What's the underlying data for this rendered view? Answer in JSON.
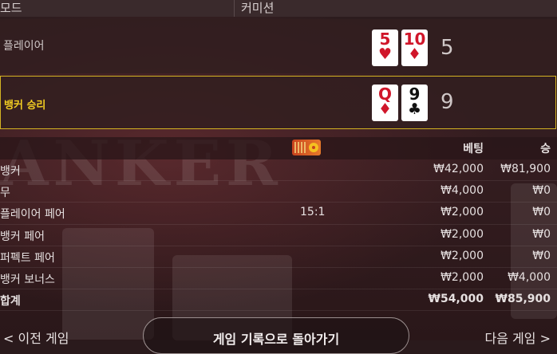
{
  "header": {
    "mode_label": "모드",
    "commission_label": "커미션"
  },
  "player": {
    "label": "플레이어",
    "cards": [
      {
        "rank": "5",
        "suit": "♥",
        "color": "red"
      },
      {
        "rank": "10",
        "suit": "♦",
        "color": "red"
      }
    ],
    "score": "5"
  },
  "banker": {
    "label": "뱅커 승리",
    "cards": [
      {
        "rank": "Q",
        "suit": "♦",
        "color": "red"
      },
      {
        "rank": "9",
        "suit": "♣",
        "color": "black"
      }
    ],
    "score": "9"
  },
  "background_text": "ANKER",
  "table": {
    "headers": {
      "bet": "베팅",
      "win": "승"
    },
    "rows": [
      {
        "name": "뱅커",
        "payout": "",
        "bet": "₩42,000",
        "win": "₩81,900"
      },
      {
        "name": "무",
        "payout": "",
        "bet": "₩4,000",
        "win": "₩0"
      },
      {
        "name": "플레이어 페어",
        "payout": "15:1",
        "bet": "₩2,000",
        "win": "₩0"
      },
      {
        "name": "뱅커 페어",
        "payout": "",
        "bet": "₩2,000",
        "win": "₩0"
      },
      {
        "name": "퍼펙트 페어",
        "payout": "",
        "bet": "₩2,000",
        "win": "₩0"
      },
      {
        "name": "뱅커 보너스",
        "payout": "",
        "bet": "₩2,000",
        "win": "₩4,000"
      }
    ],
    "total": {
      "name": "합계",
      "bet": "₩54,000",
      "win": "₩85,900"
    }
  },
  "footer": {
    "prev_label": "< 이전 게임",
    "back_label": "게임 기록으로 돌아가기",
    "next_label": "다음 게임 >"
  },
  "colors": {
    "winner_accent": "#d4b322",
    "card_red": "#d0162a"
  }
}
